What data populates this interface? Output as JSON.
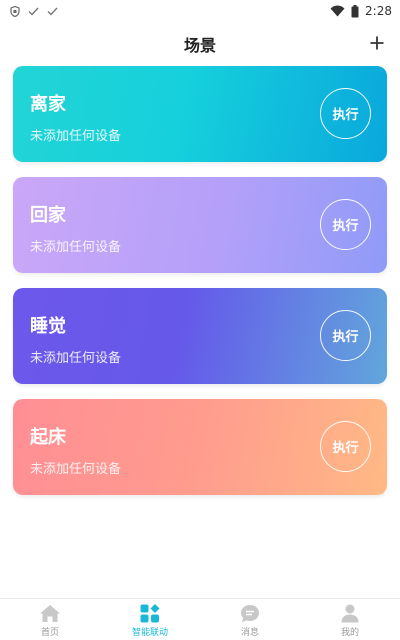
{
  "status_bar": {
    "time": "2:28"
  },
  "header": {
    "title": "场景",
    "add_label": "+"
  },
  "scenes": [
    {
      "name": "离家",
      "desc": "未添加任何设备",
      "exec_label": "执行"
    },
    {
      "name": "回家",
      "desc": "未添加任何设备",
      "exec_label": "执行"
    },
    {
      "name": "睡觉",
      "desc": "未添加任何设备",
      "exec_label": "执行"
    },
    {
      "name": "起床",
      "desc": "未添加任何设备",
      "exec_label": "执行"
    }
  ],
  "bottom_nav": [
    {
      "label": "首页",
      "icon": "home-icon"
    },
    {
      "label": "智能联动",
      "icon": "grid-icon",
      "active": true
    },
    {
      "label": "消息",
      "icon": "message-icon"
    },
    {
      "label": "我的",
      "icon": "user-icon"
    }
  ],
  "colors": {
    "accent": "#19b8d8",
    "inactive": "#c8c8c8"
  }
}
